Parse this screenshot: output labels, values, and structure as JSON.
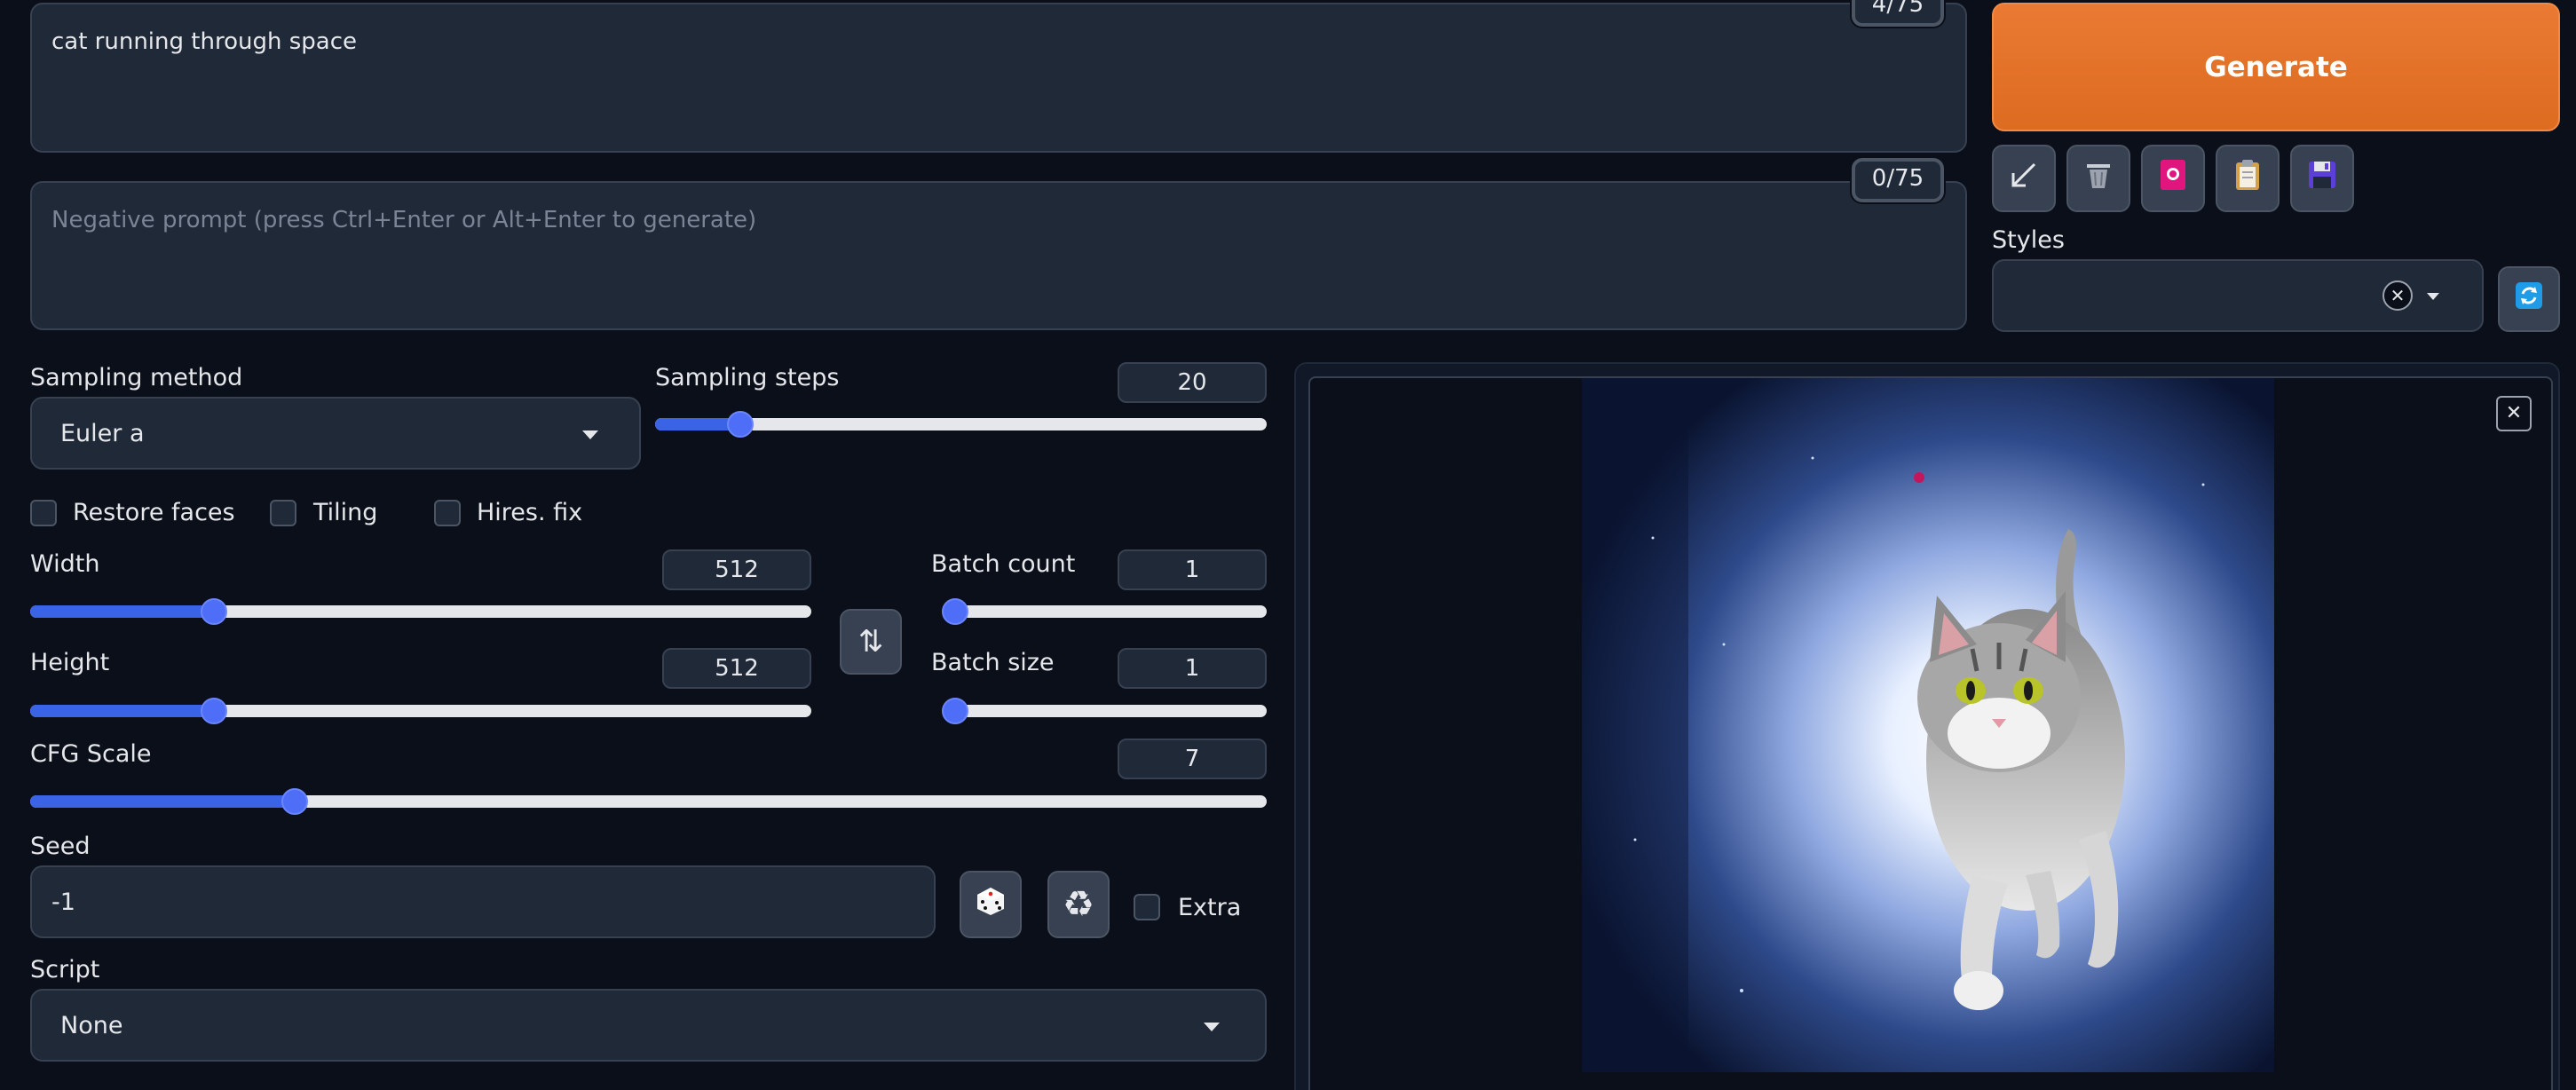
{
  "prompt": {
    "value": "cat running through space",
    "token_count": "4/75"
  },
  "negative_prompt": {
    "placeholder": "Negative prompt (press Ctrl+Enter or Alt+Enter to generate)",
    "token_count": "0/75"
  },
  "generate": {
    "label": "Generate"
  },
  "tools": [
    {
      "icon": "arrow-icon",
      "glyph": "↙"
    },
    {
      "icon": "trash-icon",
      "glyph": "🗑"
    },
    {
      "icon": "model-card-icon",
      "glyph": "🎴"
    },
    {
      "icon": "clipboard-icon",
      "glyph": "📋"
    },
    {
      "icon": "save-icon",
      "glyph": "💾"
    }
  ],
  "styles": {
    "label": "Styles",
    "clear_glyph": "✕",
    "refresh_glyph": "🔄"
  },
  "sampling_method": {
    "label": "Sampling method",
    "value": "Euler a"
  },
  "sampling_steps": {
    "label": "Sampling steps",
    "value": "20",
    "fraction": 0.14
  },
  "checkboxes": {
    "restore_faces": "Restore faces",
    "tiling": "Tiling",
    "hires_fix": "Hires. fix",
    "extra": "Extra"
  },
  "width": {
    "label": "Width",
    "value": "512",
    "fraction": 0.235
  },
  "height": {
    "label": "Height",
    "value": "512",
    "fraction": 0.235
  },
  "swap_glyph": "⇅",
  "batch_count": {
    "label": "Batch count",
    "value": "1",
    "fraction": 0.0
  },
  "batch_size": {
    "label": "Batch size",
    "value": "1",
    "fraction": 0.0
  },
  "cfg_scale": {
    "label": "CFG Scale",
    "value": "7",
    "fraction": 0.214
  },
  "seed": {
    "label": "Seed",
    "value": "-1",
    "dice_glyph": "🎲",
    "recycle_glyph": "♻"
  },
  "script": {
    "label": "Script",
    "value": "None"
  },
  "output": {
    "close_glyph": "✕"
  },
  "colors": {
    "accent": "#3b63e6",
    "generate": "#dd6b20",
    "background": "#0b0f19",
    "input": "#1f2937"
  }
}
